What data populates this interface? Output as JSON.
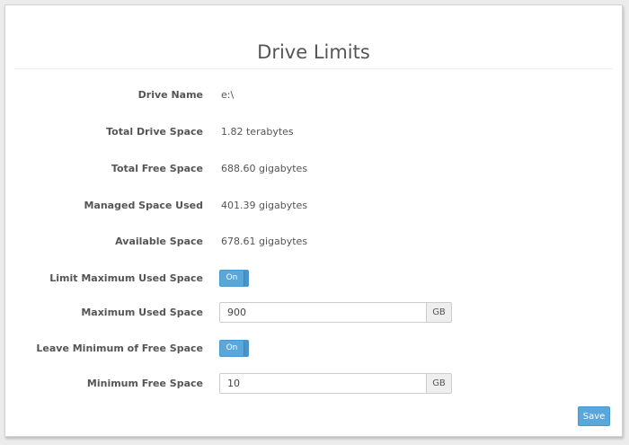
{
  "page": {
    "title": "Drive Limits"
  },
  "fields": {
    "drive_name": {
      "label": "Drive Name",
      "value": "e:\\"
    },
    "total_drive_space": {
      "label": "Total Drive Space",
      "value": "1.82 terabytes"
    },
    "total_free_space": {
      "label": "Total Free Space",
      "value": "688.60 gigabytes"
    },
    "managed_space_used": {
      "label": "Managed Space Used",
      "value": "401.39 gigabytes"
    },
    "available_space": {
      "label": "Available Space",
      "value": "678.61 gigabytes"
    },
    "limit_max_used": {
      "label": "Limit Maximum Used Space",
      "toggle_label": "On",
      "enabled": true
    },
    "max_used_space": {
      "label": "Maximum Used Space",
      "value": "900",
      "unit": "GB"
    },
    "leave_min_free": {
      "label": "Leave Minimum of Free Space",
      "toggle_label": "On",
      "enabled": true
    },
    "min_free_space": {
      "label": "Minimum Free Space",
      "value": "10",
      "unit": "GB"
    }
  },
  "actions": {
    "save_label": "Save"
  },
  "colors": {
    "accent": "#5aa7dc",
    "text": "#555555",
    "background": "#ececec"
  }
}
